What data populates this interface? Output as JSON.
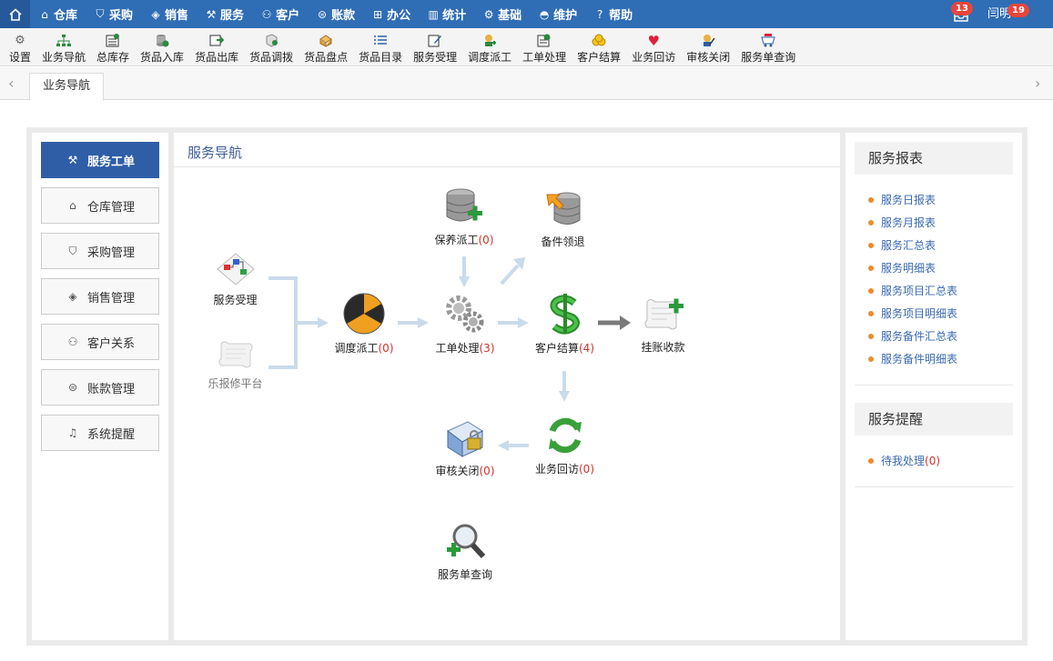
{
  "topnav": {
    "home_icon": "home-icon",
    "items": [
      {
        "label": "仓库",
        "icon": "warehouse-icon"
      },
      {
        "label": "采购",
        "icon": "cart-icon"
      },
      {
        "label": "销售",
        "icon": "tag-icon"
      },
      {
        "label": "服务",
        "icon": "wrench-icon"
      },
      {
        "label": "客户",
        "icon": "user-icon"
      },
      {
        "label": "账款",
        "icon": "money-icon"
      },
      {
        "label": "办公",
        "icon": "grid-icon"
      },
      {
        "label": "统计",
        "icon": "bar-chart-icon"
      },
      {
        "label": "基础",
        "icon": "gear-icon"
      },
      {
        "label": "维护",
        "icon": "drop-icon"
      },
      {
        "label": "帮助",
        "icon": "help-icon"
      }
    ],
    "notifications_count": "13",
    "user_name": "闫明",
    "user_badge": "19",
    "accent": "#2f6db5"
  },
  "toolbar": {
    "items": [
      {
        "label": "设置",
        "icon": "gear-icon"
      },
      {
        "label": "业务导航",
        "icon": "sitemap-icon"
      },
      {
        "label": "总库存",
        "icon": "inventory-icon"
      },
      {
        "label": "货品入库",
        "icon": "stock-in-icon"
      },
      {
        "label": "货品出库",
        "icon": "stock-out-icon"
      },
      {
        "label": "货品调拨",
        "icon": "transfer-icon"
      },
      {
        "label": "货品盘点",
        "icon": "stocktake-icon"
      },
      {
        "label": "货品目录",
        "icon": "list-icon"
      },
      {
        "label": "服务受理",
        "icon": "edit-icon"
      },
      {
        "label": "调度派工",
        "icon": "dispatch-icon"
      },
      {
        "label": "工单处理",
        "icon": "workorder-icon"
      },
      {
        "label": "客户结算",
        "icon": "coins-icon"
      },
      {
        "label": "业务回访",
        "icon": "heart-icon"
      },
      {
        "label": "审核关闭",
        "icon": "audit-icon"
      },
      {
        "label": "服务单查询",
        "icon": "cart-search-icon"
      }
    ]
  },
  "tabs": {
    "active": "业务导航"
  },
  "left_menu": {
    "items": [
      {
        "label": "服务工单",
        "icon": "wrench-icon",
        "active": true
      },
      {
        "label": "仓库管理",
        "icon": "warehouse-icon",
        "active": false
      },
      {
        "label": "采购管理",
        "icon": "cart-icon",
        "active": false
      },
      {
        "label": "销售管理",
        "icon": "tag-icon",
        "active": false
      },
      {
        "label": "客户关系",
        "icon": "user-icon",
        "active": false
      },
      {
        "label": "账款管理",
        "icon": "money-icon",
        "active": false
      },
      {
        "label": "系统提醒",
        "icon": "bell-icon",
        "active": false
      }
    ]
  },
  "center": {
    "title": "服务导航",
    "nodes": {
      "service_accept": {
        "label": "服务受理",
        "count": ""
      },
      "lebaoxiu": {
        "label": "乐报修平台",
        "count": ""
      },
      "dispatch": {
        "label": "调度派工",
        "count": "(0)"
      },
      "maintenance_dispatch": {
        "label": "保养派工",
        "count": "(0)"
      },
      "parts_return": {
        "label": "备件领退",
        "count": ""
      },
      "work_order": {
        "label": "工单处理",
        "count": "(3)"
      },
      "settlement": {
        "label": "客户结算",
        "count": "(4)"
      },
      "credit": {
        "label": "挂账收款",
        "count": ""
      },
      "revisit": {
        "label": "业务回访",
        "count": "(0)"
      },
      "audit_close": {
        "label": "审核关闭",
        "count": "(0)"
      },
      "query": {
        "label": "服务单查询",
        "count": ""
      }
    }
  },
  "right": {
    "reports_title": "服务报表",
    "reports": [
      "服务日报表",
      "服务月报表",
      "服务汇总表",
      "服务明细表",
      "服务项目汇总表",
      "服务项目明细表",
      "服务备件汇总表",
      "服务备件明细表"
    ],
    "reminders_title": "服务提醒",
    "reminders": [
      {
        "label": "待我处理",
        "count": "(0)"
      }
    ]
  }
}
